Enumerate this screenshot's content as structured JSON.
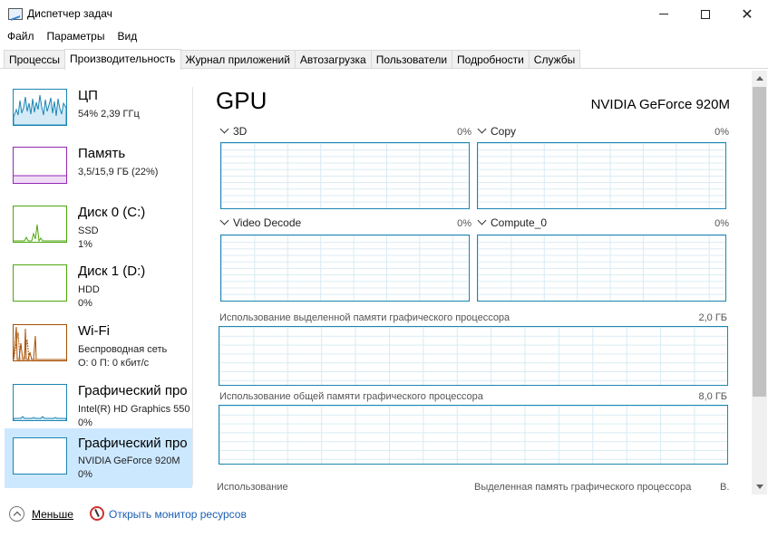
{
  "window": {
    "title": "Диспетчер задач"
  },
  "menu": [
    "Файл",
    "Параметры",
    "Вид"
  ],
  "tabs": [
    "Процессы",
    "Производительность",
    "Журнал приложений",
    "Автозагрузка",
    "Пользователи",
    "Подробности",
    "Службы"
  ],
  "active_tab": "Производительность",
  "sidebar": {
    "items": [
      {
        "name": "ЦП",
        "line1": "54%  2,39 ГГц",
        "line2": "",
        "color": "#1c86b3",
        "chart": "cpu"
      },
      {
        "name": "Память",
        "line1": "3,5/15,9 ГБ (22%)",
        "line2": "",
        "color": "#9528b4",
        "chart": "memory"
      },
      {
        "name": "Диск 0 (C:)",
        "line1": "SSD",
        "line2": "1%",
        "color": "#4da60c",
        "chart": "disk0"
      },
      {
        "name": "Диск 1 (D:)",
        "line1": "HDD",
        "line2": "0%",
        "color": "#4da60c",
        "chart": "disk1"
      },
      {
        "name": "Wi-Fi",
        "line1": "Беспроводная сеть",
        "line2": "О: 0 П: 0 кбит/с",
        "color": "#a74f01",
        "chart": "wifi"
      },
      {
        "name": "Графический про",
        "line1": "Intel(R) HD Graphics 550",
        "line2": "0%",
        "color": "#1c86b3",
        "chart": "gpu0"
      },
      {
        "name": "Графический про",
        "line1": "NVIDIA GeForce 920M",
        "line2": "0%",
        "color": "#1c86b3",
        "chart": "gpu1"
      }
    ],
    "selected_index": 6
  },
  "main": {
    "title": "GPU",
    "device": "NVIDIA GeForce 920M",
    "engines": [
      {
        "label": "3D",
        "percent": "0%"
      },
      {
        "label": "Copy",
        "percent": "0%"
      },
      {
        "label": "Video Decode",
        "percent": "0%"
      },
      {
        "label": "Compute_0",
        "percent": "0%"
      }
    ],
    "dedicated": {
      "label": "Использование выделенной памяти графического процессора",
      "max": "2,0 ГБ"
    },
    "shared": {
      "label": "Использование общей памяти графического процессора",
      "max": "8,0 ГБ"
    },
    "bottom": {
      "usage": "Использование",
      "dedicated_mem": "Выделенная память графического процессора",
      "truncated": "В."
    }
  },
  "footer": {
    "fewer": "Меньше",
    "resmon": "Открыть монитор ресурсов"
  },
  "colors": {
    "graph_border": "#1c86b3",
    "selected_bg": "#cce8ff",
    "link": "#1a5fb4"
  }
}
